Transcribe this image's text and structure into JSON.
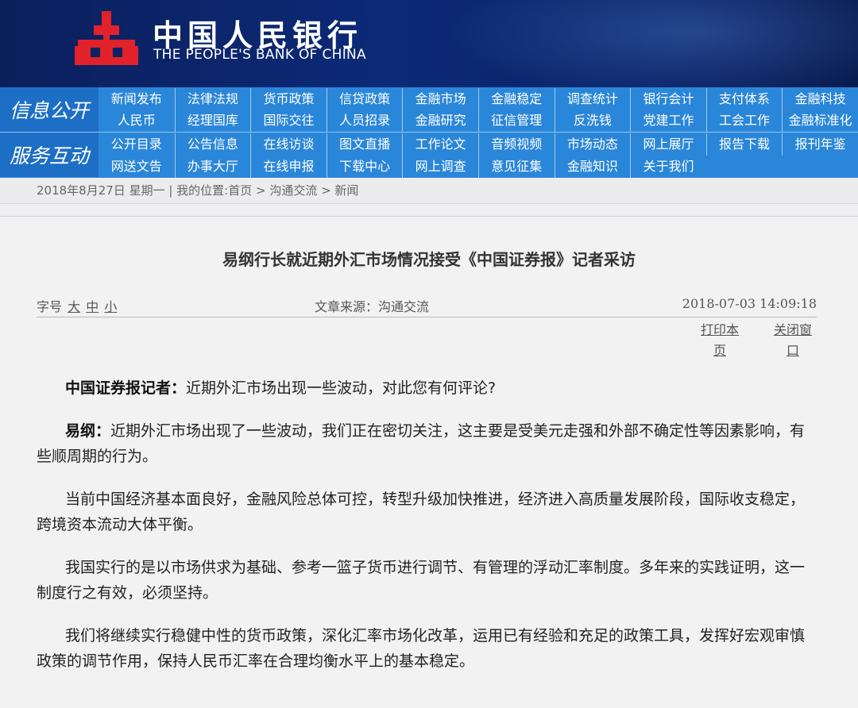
{
  "banner": {
    "name_cn": "中国人民银行",
    "name_en": "THE PEOPLE'S BANK OF CHINA"
  },
  "colors": {
    "banner": "#0c2a78",
    "nav": "#2a86d8",
    "section": "#1d6fc5",
    "logo": "#e1222b"
  },
  "nav": {
    "section1": "信息公开",
    "section2": "服务互动",
    "row1": [
      "新闻发布",
      "法律法规",
      "货币政策",
      "信贷政策",
      "金融市场",
      "金融稳定",
      "调查统计",
      "银行会计",
      "支付体系",
      "金融科技"
    ],
    "row2": [
      "人民币",
      "经理国库",
      "国际交往",
      "人员招录",
      "金融研究",
      "征信管理",
      "反洗钱",
      "党建工作",
      "工会工作",
      "金融标准化"
    ],
    "row3": [
      "公开目录",
      "公告信息",
      "在线访谈",
      "图文直播",
      "工作论文",
      "音频视频",
      "市场动态",
      "网上展厅",
      "报告下载",
      "报刊年鉴"
    ],
    "row4": [
      "网送文告",
      "办事大厅",
      "在线申报",
      "下载中心",
      "网上调查",
      "意见征集",
      "金融知识",
      "关于我们"
    ]
  },
  "breadcrumb": {
    "text": "2018年8月27日 星期一 | 我的位置:首页 > 沟通交流 > 新闻"
  },
  "article": {
    "title": "易纲行长就近期外汇市场情况接受《中国证券报》记者采访",
    "fontsize_label": "字号",
    "size_large": "大",
    "size_medium": "中",
    "size_small": "小",
    "source": "文章来源：沟通交流",
    "date": "2018-07-03 14:09:18",
    "print_label": "打印本页",
    "close_label": "关闭窗口",
    "q_speaker": "中国证券报记者：",
    "q_text": "近期外汇市场出现一些波动，对此您有何评论?",
    "a_speaker": "易纲：",
    "a_text": "近期外汇市场出现了一些波动，我们正在密切关注，这主要是受美元走强和外部不确定性等因素影响，有些顺周期的行为。",
    "p2": "当前中国经济基本面良好，金融风险总体可控，转型升级加快推进，经济进入高质量发展阶段，国际收支稳定，跨境资本流动大体平衡。",
    "p3": "我国实行的是以市场供求为基础、参考一篮子货币进行调节、有管理的浮动汇率制度。多年来的实践证明，这一制度行之有效，必须坚持。",
    "p4": "我们将继续实行稳健中性的货币政策，深化汇率市场化改革，运用已有经验和充足的政策工具，发挥好宏观审慎政策的调节作用，保持人民币汇率在合理均衡水平上的基本稳定。"
  }
}
